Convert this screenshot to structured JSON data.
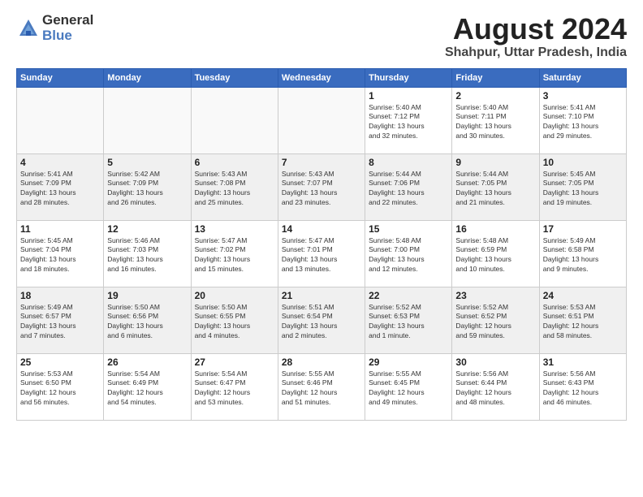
{
  "logo": {
    "general": "General",
    "blue": "Blue"
  },
  "header": {
    "title": "August 2024",
    "subtitle": "Shahpur, Uttar Pradesh, India"
  },
  "days_of_week": [
    "Sunday",
    "Monday",
    "Tuesday",
    "Wednesday",
    "Thursday",
    "Friday",
    "Saturday"
  ],
  "weeks": [
    {
      "days": [
        {
          "num": "",
          "info": ""
        },
        {
          "num": "",
          "info": ""
        },
        {
          "num": "",
          "info": ""
        },
        {
          "num": "",
          "info": ""
        },
        {
          "num": "1",
          "info": "Sunrise: 5:40 AM\nSunset: 7:12 PM\nDaylight: 13 hours\nand 32 minutes."
        },
        {
          "num": "2",
          "info": "Sunrise: 5:40 AM\nSunset: 7:11 PM\nDaylight: 13 hours\nand 30 minutes."
        },
        {
          "num": "3",
          "info": "Sunrise: 5:41 AM\nSunset: 7:10 PM\nDaylight: 13 hours\nand 29 minutes."
        }
      ]
    },
    {
      "days": [
        {
          "num": "4",
          "info": "Sunrise: 5:41 AM\nSunset: 7:09 PM\nDaylight: 13 hours\nand 28 minutes."
        },
        {
          "num": "5",
          "info": "Sunrise: 5:42 AM\nSunset: 7:09 PM\nDaylight: 13 hours\nand 26 minutes."
        },
        {
          "num": "6",
          "info": "Sunrise: 5:43 AM\nSunset: 7:08 PM\nDaylight: 13 hours\nand 25 minutes."
        },
        {
          "num": "7",
          "info": "Sunrise: 5:43 AM\nSunset: 7:07 PM\nDaylight: 13 hours\nand 23 minutes."
        },
        {
          "num": "8",
          "info": "Sunrise: 5:44 AM\nSunset: 7:06 PM\nDaylight: 13 hours\nand 22 minutes."
        },
        {
          "num": "9",
          "info": "Sunrise: 5:44 AM\nSunset: 7:05 PM\nDaylight: 13 hours\nand 21 minutes."
        },
        {
          "num": "10",
          "info": "Sunrise: 5:45 AM\nSunset: 7:05 PM\nDaylight: 13 hours\nand 19 minutes."
        }
      ]
    },
    {
      "days": [
        {
          "num": "11",
          "info": "Sunrise: 5:45 AM\nSunset: 7:04 PM\nDaylight: 13 hours\nand 18 minutes."
        },
        {
          "num": "12",
          "info": "Sunrise: 5:46 AM\nSunset: 7:03 PM\nDaylight: 13 hours\nand 16 minutes."
        },
        {
          "num": "13",
          "info": "Sunrise: 5:47 AM\nSunset: 7:02 PM\nDaylight: 13 hours\nand 15 minutes."
        },
        {
          "num": "14",
          "info": "Sunrise: 5:47 AM\nSunset: 7:01 PM\nDaylight: 13 hours\nand 13 minutes."
        },
        {
          "num": "15",
          "info": "Sunrise: 5:48 AM\nSunset: 7:00 PM\nDaylight: 13 hours\nand 12 minutes."
        },
        {
          "num": "16",
          "info": "Sunrise: 5:48 AM\nSunset: 6:59 PM\nDaylight: 13 hours\nand 10 minutes."
        },
        {
          "num": "17",
          "info": "Sunrise: 5:49 AM\nSunset: 6:58 PM\nDaylight: 13 hours\nand 9 minutes."
        }
      ]
    },
    {
      "days": [
        {
          "num": "18",
          "info": "Sunrise: 5:49 AM\nSunset: 6:57 PM\nDaylight: 13 hours\nand 7 minutes."
        },
        {
          "num": "19",
          "info": "Sunrise: 5:50 AM\nSunset: 6:56 PM\nDaylight: 13 hours\nand 6 minutes."
        },
        {
          "num": "20",
          "info": "Sunrise: 5:50 AM\nSunset: 6:55 PM\nDaylight: 13 hours\nand 4 minutes."
        },
        {
          "num": "21",
          "info": "Sunrise: 5:51 AM\nSunset: 6:54 PM\nDaylight: 13 hours\nand 2 minutes."
        },
        {
          "num": "22",
          "info": "Sunrise: 5:52 AM\nSunset: 6:53 PM\nDaylight: 13 hours\nand 1 minute."
        },
        {
          "num": "23",
          "info": "Sunrise: 5:52 AM\nSunset: 6:52 PM\nDaylight: 12 hours\nand 59 minutes."
        },
        {
          "num": "24",
          "info": "Sunrise: 5:53 AM\nSunset: 6:51 PM\nDaylight: 12 hours\nand 58 minutes."
        }
      ]
    },
    {
      "days": [
        {
          "num": "25",
          "info": "Sunrise: 5:53 AM\nSunset: 6:50 PM\nDaylight: 12 hours\nand 56 minutes."
        },
        {
          "num": "26",
          "info": "Sunrise: 5:54 AM\nSunset: 6:49 PM\nDaylight: 12 hours\nand 54 minutes."
        },
        {
          "num": "27",
          "info": "Sunrise: 5:54 AM\nSunset: 6:47 PM\nDaylight: 12 hours\nand 53 minutes."
        },
        {
          "num": "28",
          "info": "Sunrise: 5:55 AM\nSunset: 6:46 PM\nDaylight: 12 hours\nand 51 minutes."
        },
        {
          "num": "29",
          "info": "Sunrise: 5:55 AM\nSunset: 6:45 PM\nDaylight: 12 hours\nand 49 minutes."
        },
        {
          "num": "30",
          "info": "Sunrise: 5:56 AM\nSunset: 6:44 PM\nDaylight: 12 hours\nand 48 minutes."
        },
        {
          "num": "31",
          "info": "Sunrise: 5:56 AM\nSunset: 6:43 PM\nDaylight: 12 hours\nand 46 minutes."
        }
      ]
    }
  ]
}
